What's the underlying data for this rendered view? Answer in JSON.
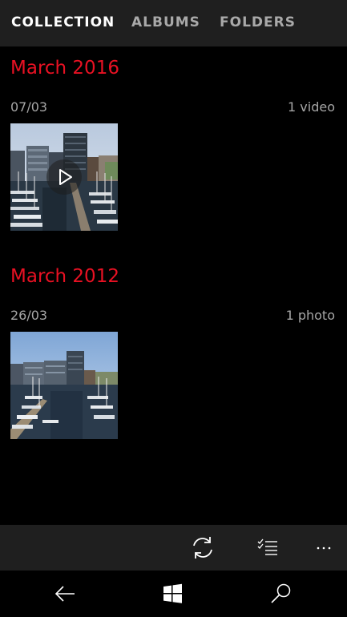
{
  "pivot": {
    "tabs": [
      {
        "label": "COLLECTION",
        "active": true
      },
      {
        "label": "ALBUMS",
        "active": false
      },
      {
        "label": "FOLDERS",
        "active": false
      }
    ]
  },
  "groups": [
    {
      "title": "March 2016",
      "date": "07/03",
      "count": "1 video",
      "media_type": "video"
    },
    {
      "title": "March 2012",
      "date": "26/03",
      "count": "1 photo",
      "media_type": "photo"
    }
  ],
  "appbar": {
    "icons": [
      "sync-icon",
      "select-list-icon",
      "more-icon"
    ],
    "more_label": "···"
  },
  "navbar": {
    "icons": [
      "back-icon",
      "windows-start-icon",
      "search-icon"
    ]
  },
  "colors": {
    "accent": "#e81123",
    "header_bg": "#1f1f1f",
    "inactive_tab": "#a9a9a9",
    "meta_text": "#a6a6a6"
  }
}
